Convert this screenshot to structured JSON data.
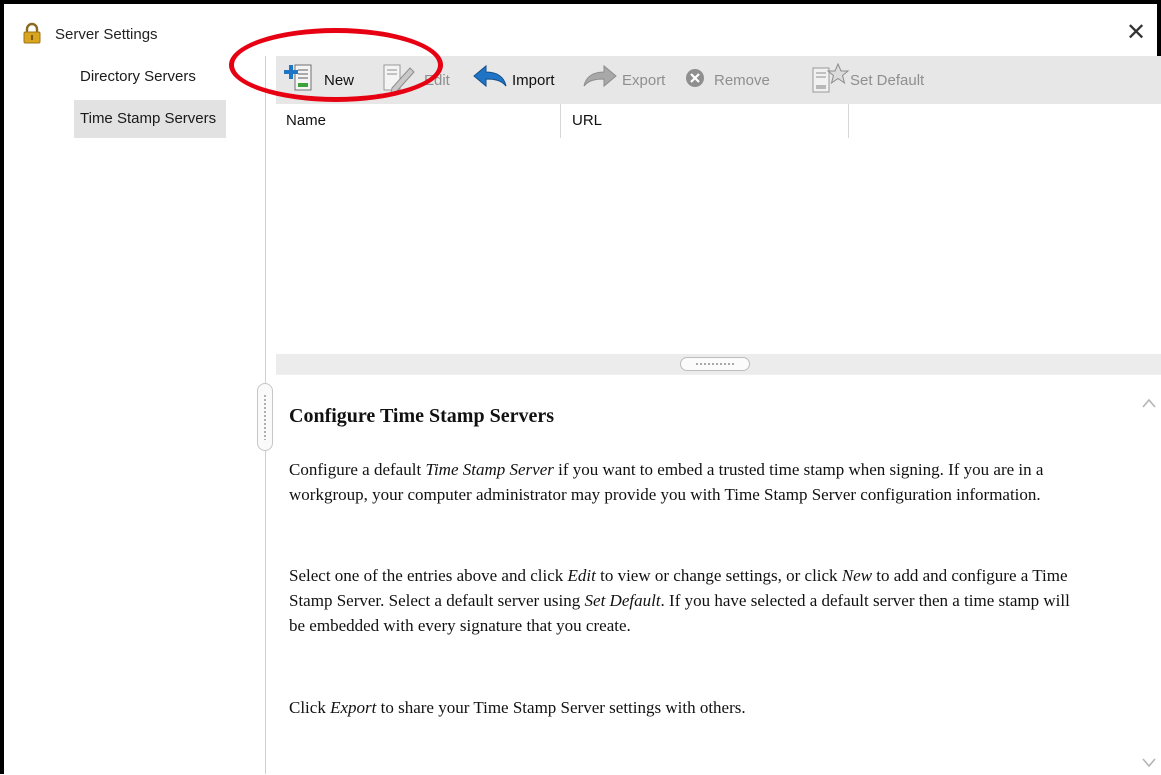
{
  "window": {
    "title": "Server Settings",
    "close_symbol": "✕"
  },
  "sidebar": {
    "items": [
      {
        "label": "Directory Servers",
        "selected": false
      },
      {
        "label": "Time Stamp Servers",
        "selected": true
      }
    ]
  },
  "toolbar": {
    "new": "New",
    "edit": "Edit",
    "import": "Import",
    "export": "Export",
    "remove": "Remove",
    "set_default": "Set Default"
  },
  "list": {
    "columns": [
      "Name",
      "URL"
    ],
    "rows": []
  },
  "help": {
    "title": "Configure Time Stamp Servers",
    "p1": {
      "a": "Configure a default ",
      "i1": "Time Stamp Server",
      "b": " if you want to embed a trusted time stamp when signing. If you are in a workgroup, your computer administrator may provide you with Time Stamp Server configuration information."
    },
    "p2": {
      "a": "Select one of the entries above and click ",
      "i1": "Edit",
      "b": " to view or change settings, or click ",
      "i2": "New",
      "c": " to add and configure a Time Stamp Server. Select a default server using ",
      "i3": "Set Default",
      "d": ". If you have selected a default server then a time stamp will be embedded with every signature that you create."
    },
    "p3": {
      "a": "Click ",
      "i1": "Export",
      "b": " to share your Time Stamp Server settings with others."
    }
  },
  "colors": {
    "annotation": "#e60012",
    "toolbar_bg": "#e7e7e7",
    "selected_bg": "#e2e2e2",
    "icon_blue": "#1f74c6"
  },
  "icons": [
    "lock-icon",
    "close-icon",
    "new-server-icon",
    "edit-icon",
    "import-arrow-icon",
    "export-arrow-icon",
    "remove-icon",
    "set-default-icon",
    "scroll-up-icon",
    "scroll-down-icon"
  ]
}
